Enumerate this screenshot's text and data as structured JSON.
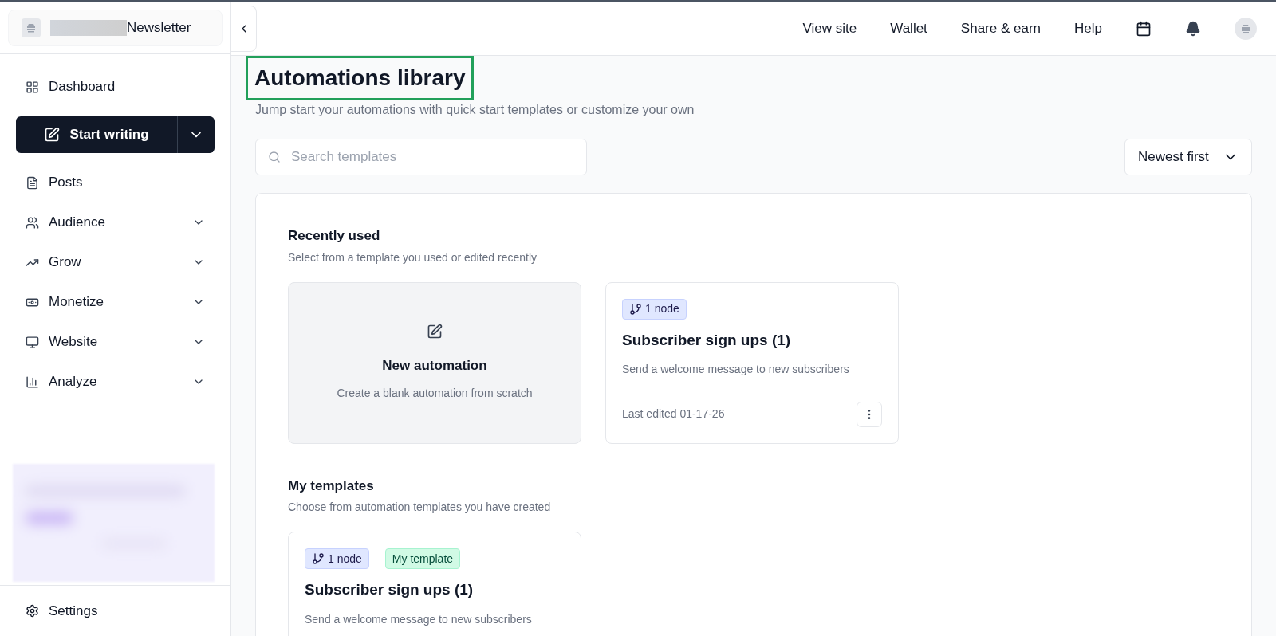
{
  "sidebar": {
    "publication": "Newsletter",
    "items": [
      {
        "label": "Dashboard",
        "expandable": false
      },
      {
        "label": "Posts",
        "expandable": false
      },
      {
        "label": "Audience",
        "expandable": true
      },
      {
        "label": "Grow",
        "expandable": true
      },
      {
        "label": "Monetize",
        "expandable": true
      },
      {
        "label": "Website",
        "expandable": true
      },
      {
        "label": "Analyze",
        "expandable": true
      }
    ],
    "primary_button": "Start writing",
    "settings": "Settings"
  },
  "topbar": {
    "links": [
      "View site",
      "Wallet",
      "Share & earn",
      "Help"
    ]
  },
  "page": {
    "title": "Automations library",
    "subtitle": "Jump start your automations with quick start templates or customize your own",
    "search": {
      "placeholder": "Search templates"
    },
    "sort": "Newest first"
  },
  "sections": [
    {
      "title": "Recently used",
      "subtitle": "Select from a template you used or edited recently",
      "cards": [
        {
          "kind": "new",
          "title": "New automation",
          "description": "Create a blank automation from scratch"
        },
        {
          "kind": "template",
          "badges": [
            {
              "kind": "node",
              "label": "1 node"
            }
          ],
          "title": "Subscriber sign ups (1)",
          "description": "Send a welcome message to new subscribers",
          "footer": "Last edited 01-17-26"
        }
      ]
    },
    {
      "title": "My templates",
      "subtitle": "Choose from automation templates you have created",
      "cards": [
        {
          "kind": "template",
          "badges": [
            {
              "kind": "node",
              "label": "1 node"
            },
            {
              "kind": "mine",
              "label": "My template"
            }
          ],
          "title": "Subscriber sign ups (1)",
          "description": "Send a welcome message to new subscribers"
        }
      ]
    }
  ]
}
